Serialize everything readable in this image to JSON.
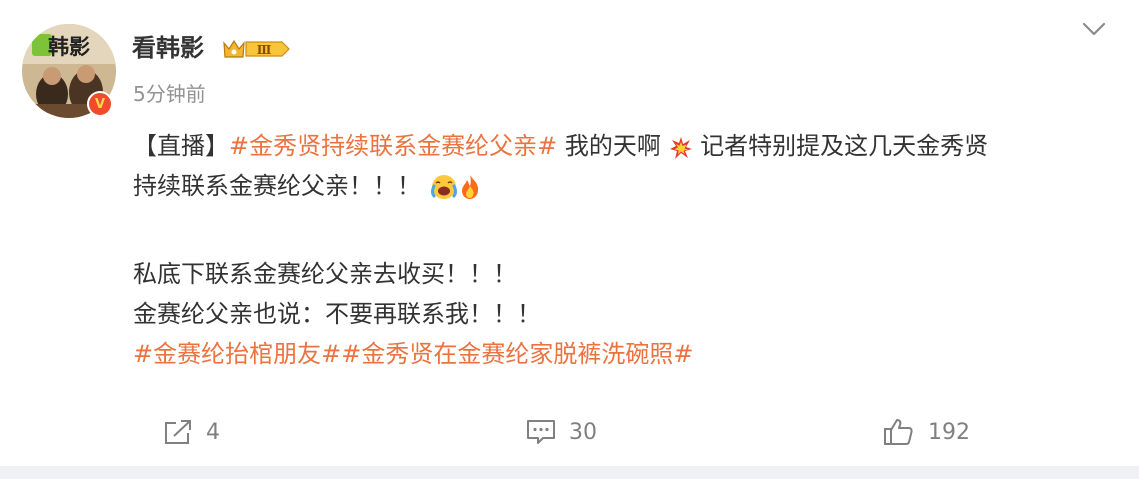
{
  "post": {
    "author": {
      "name": "看韩影",
      "avatar_text": "韩影",
      "verify_mark": "V",
      "vip_level": "Ⅲ"
    },
    "time": "5分钟前",
    "body": {
      "prefix": "【直播】",
      "hashtag_1": "#金秀贤持续联系金赛纶父亲#",
      "text_1": " 我的天啊",
      "text_2": " 记者特别提及这几天金秀贤",
      "text_3": "持续联系金赛纶父亲！！！",
      "text_4": "私底下联系金赛纶父亲去收买！！！",
      "text_5": "金赛纶父亲也说：不要再联系我！！！",
      "hashtag_2": "#金赛纶抬棺朋友#",
      "hashtag_3": "#金秀贤在金赛纶家脱裤洗碗照#"
    },
    "actions": {
      "share_count": "4",
      "comment_count": "30",
      "like_count": "192"
    }
  },
  "colors": {
    "hashtag": "#eb7340",
    "text": "#333333",
    "meta": "#939393",
    "action": "#808080"
  },
  "icons": {
    "menu": "chevron-down-icon",
    "share": "share-icon",
    "comment": "comment-icon",
    "like": "thumbs-up-icon",
    "emoji_1": "explosion-emoji",
    "emoji_2": "crying-face-emoji",
    "emoji_3": "fire-emoji"
  }
}
